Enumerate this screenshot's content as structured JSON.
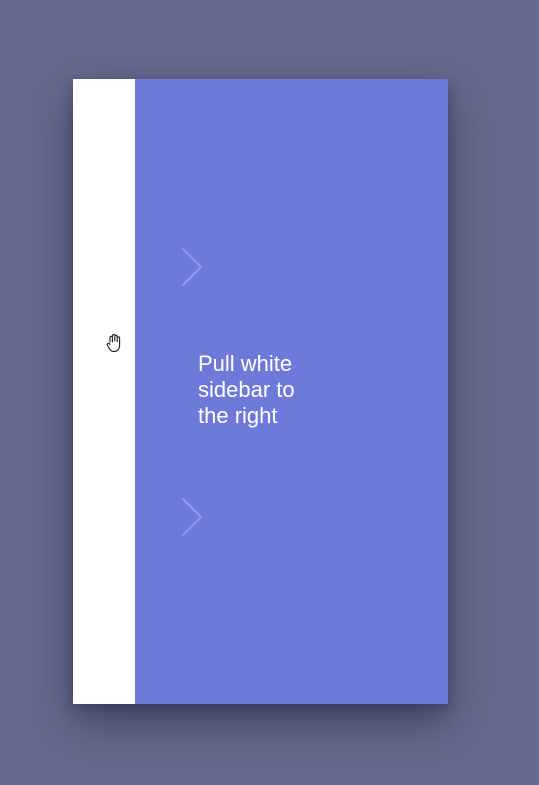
{
  "hint": {
    "text": "Pull white\nsidebar to\nthe right"
  },
  "icons": {
    "grab": "hand-grab-icon",
    "chevron": "chevron-right-icon"
  },
  "colors": {
    "background": "#676a8e",
    "panel": "#6e7ad9",
    "sidebar": "#ffffff",
    "text": "#ffffff"
  }
}
